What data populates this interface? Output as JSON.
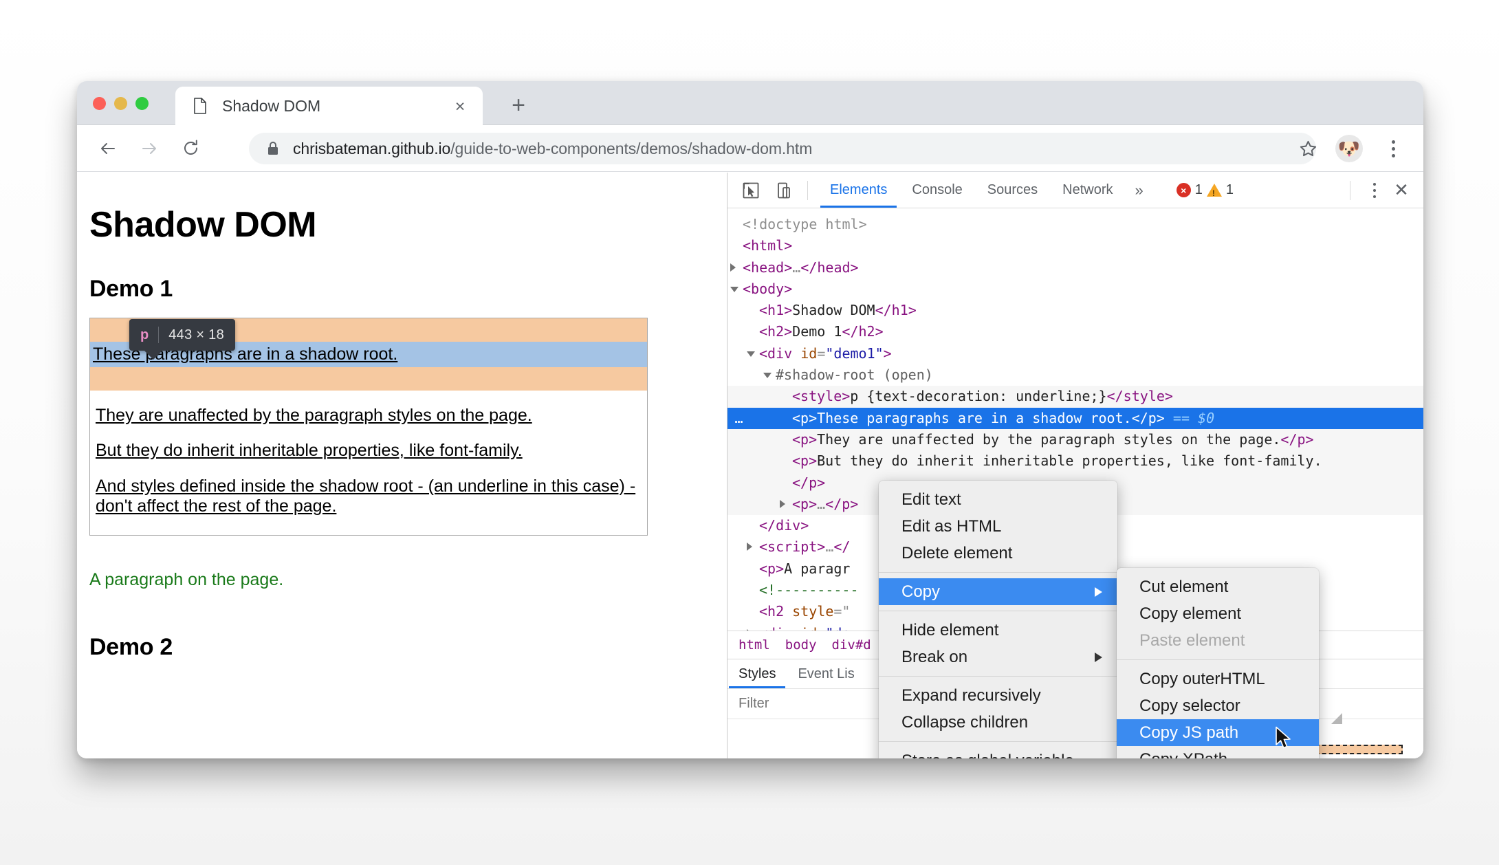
{
  "browser": {
    "tab": {
      "title": "Shadow DOM",
      "favicon": "document-icon",
      "close_label": "×"
    },
    "new_tab_label": "+",
    "omnibox": {
      "lock_icon": "lock-icon",
      "domain": "chrisbateman.github.io",
      "path": "/guide-to-web-components/demos/shadow-dom.htm",
      "star_icon": "star-icon",
      "avatar_icon": "🐶",
      "menu_icon": "kebab-menu-icon"
    },
    "nav": {
      "back": "←",
      "forward": "→",
      "reload": "↻"
    }
  },
  "page": {
    "h1": "Shadow DOM",
    "h2_demo1": "Demo 1",
    "h2_demo2": "Demo 2",
    "shadow_paragraphs": [
      "These paragraphs are in a shadow root.",
      "They are unaffected by the paragraph styles on the page.",
      "But they do inherit inheritable properties, like font-family.",
      "And styles defined inside the shadow root - (an underline in this case) - don't affect the rest of the page."
    ],
    "page_paragraph": "A paragraph on the page.",
    "inspect_badge": {
      "tag": "p",
      "dimensions": "443 × 18"
    }
  },
  "devtools": {
    "icons": {
      "inspect": "cursor-select-icon",
      "device": "device-toolbar-icon"
    },
    "tabs": [
      {
        "label": "Elements",
        "active": true
      },
      {
        "label": "Console",
        "active": false
      },
      {
        "label": "Sources",
        "active": false
      },
      {
        "label": "Network",
        "active": false
      }
    ],
    "more_tabs": "»",
    "counters": {
      "errors": "1",
      "warnings": "1"
    },
    "kebab": "kebab-menu-icon",
    "close": "✕",
    "dom": [
      {
        "indent": 0,
        "html": "<span class='doctype'>&lt;!doctype html&gt;</span>"
      },
      {
        "indent": 0,
        "html": "<span class='tag'>&lt;html&gt;</span>"
      },
      {
        "indent": 0,
        "arrow": "closed",
        "html": "<span class='tag'>&lt;head&gt;</span><span class='punc'>…</span><span class='tag'>&lt;/head&gt;</span>"
      },
      {
        "indent": 0,
        "arrow": "open",
        "html": "<span class='tag'>&lt;body&gt;</span>"
      },
      {
        "indent": 1,
        "html": "<span class='tag'>&lt;h1&gt;</span><span class='txt'>Shadow DOM</span><span class='tag'>&lt;/h1&gt;</span>"
      },
      {
        "indent": 1,
        "html": "<span class='tag'>&lt;h2&gt;</span><span class='txt'>Demo 1</span><span class='tag'>&lt;/h2&gt;</span>"
      },
      {
        "indent": 1,
        "arrow": "open",
        "html": "<span class='tag'>&lt;div</span> <span class='attr-name'>id</span><span class='punc'>=</span><span class='attr-val'>\"demo1\"</span><span class='tag'>&gt;</span>"
      },
      {
        "indent": 2,
        "arrow": "open",
        "html": "<span class='shadow'>#shadow-root (open)</span>"
      },
      {
        "indent": 3,
        "shaded": true,
        "html": "<span class='tag'>&lt;style&gt;</span><span class='txt'>p {text-decoration: underline;}</span><span class='tag'>&lt;/style&gt;</span>"
      },
      {
        "indent": 3,
        "selected": true,
        "ellipsis": "…",
        "html": "<span class='tag'>&lt;p&gt;</span><span class='txt'>These paragraphs are in a shadow root.</span><span class='tag'>&lt;/p&gt;</span> <span class='eq'>==</span> <span class='dollar'>$0</span>"
      },
      {
        "indent": 3,
        "shaded": true,
        "html": "<span class='tag'>&lt;p&gt;</span><span class='txt'>They are unaffected by the paragraph styles on the page.</span><span class='tag'>&lt;/p&gt;</span>"
      },
      {
        "indent": 3,
        "shaded": true,
        "html": "<span class='tag'>&lt;p&gt;</span><span class='txt'>But they do inherit inheritable properties, like font-family.</span>"
      },
      {
        "indent": 3,
        "shaded": true,
        "html": "<span class='tag'>&lt;/p&gt;</span>"
      },
      {
        "indent": 3,
        "shaded": true,
        "arrow": "closed",
        "html": "<span class='tag'>&lt;p&gt;</span><span class='punc'>…</span><span class='tag'>&lt;/p&gt;</span>"
      },
      {
        "indent": 1,
        "html": "<span class='tag'>&lt;/div&gt;</span>"
      },
      {
        "indent": 1,
        "arrow": "closed",
        "html": "<span class='tag'>&lt;script&gt;</span><span class='punc'>…</span><span class='tag'>&lt;/</span>"
      },
      {
        "indent": 1,
        "html": "<span class='tag'>&lt;p&gt;</span><span class='txt'>A paragr</span>"
      },
      {
        "indent": 1,
        "html": "<span class='comment'>&lt;!----------</span>"
      },
      {
        "indent": 1,
        "html": "<span class='tag'>&lt;h2</span> <span class='attr-name'>style</span><span class='punc'>=\"</span>"
      },
      {
        "indent": 1,
        "arrow": "closed",
        "html": "<span class='tag'>&lt;div</span> <span class='attr-name'>id</span><span class='punc'>=</span><span class='attr-val'>\"de</span>"
      }
    ],
    "breadcrumb": [
      "html",
      "body",
      "div#d"
    ],
    "styles_tabs": [
      {
        "label": "Styles",
        "active": true
      },
      {
        "label": "Event Lis",
        "active": false
      }
    ],
    "filter_placeholder": "Filter"
  },
  "context_menu": {
    "items": [
      {
        "label": "Edit text",
        "type": "item"
      },
      {
        "label": "Edit as HTML",
        "type": "item"
      },
      {
        "label": "Delete element",
        "type": "item"
      },
      {
        "type": "separator"
      },
      {
        "label": "Copy",
        "type": "submenu",
        "highlight": true
      },
      {
        "type": "separator"
      },
      {
        "label": "Hide element",
        "type": "item"
      },
      {
        "label": "Break on",
        "type": "submenu"
      },
      {
        "type": "separator"
      },
      {
        "label": "Expand recursively",
        "type": "item"
      },
      {
        "label": "Collapse children",
        "type": "item"
      },
      {
        "type": "separator"
      },
      {
        "label": "Store as global variable",
        "type": "item"
      }
    ],
    "submenu": {
      "items": [
        {
          "label": "Cut element",
          "type": "item"
        },
        {
          "label": "Copy element",
          "type": "item"
        },
        {
          "label": "Paste element",
          "type": "item",
          "disabled": true
        },
        {
          "type": "separator"
        },
        {
          "label": "Copy outerHTML",
          "type": "item"
        },
        {
          "label": "Copy selector",
          "type": "item"
        },
        {
          "label": "Copy JS path",
          "type": "item",
          "highlight": true
        },
        {
          "label": "Copy XPath",
          "type": "item"
        }
      ]
    }
  },
  "colors": {
    "accent": "#1a73e8",
    "menu_highlight": "#3b8bf0",
    "shadow_highlight": "#a4c3e5",
    "padding_highlight": "#f6c9a0",
    "error_red": "#d93025",
    "warning_orange": "#f5a623",
    "green_text": "#1a7a1a"
  }
}
